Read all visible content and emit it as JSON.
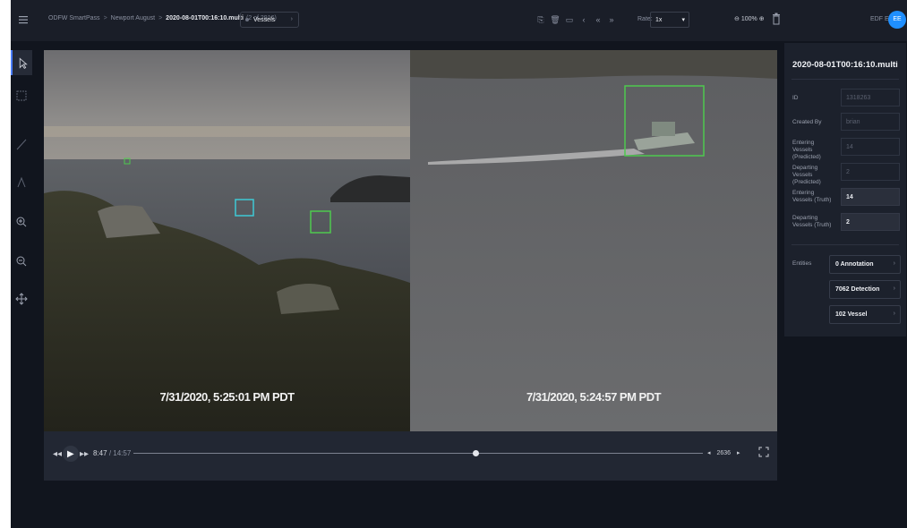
{
  "breadcrumb": [
    "ODFW SmartPass",
    "Newport August",
    "2020-08-01T00:16:10.multi"
  ],
  "breadcrumb_count": "(2 of 2916)",
  "vessel_filter": "Vessels",
  "rate": {
    "label": "Rate:",
    "value": "1x"
  },
  "zoom": "100%",
  "user_name": "EDF EDF",
  "avatar_initials": "EE",
  "tools": [
    "pointer-tool",
    "box-tool",
    "line-tool",
    "point-tool",
    "zoom-in-tool",
    "zoom-out-tool",
    "pan-tool"
  ],
  "cameras": [
    {
      "timestamp": "7/31/2020, 5:25:01 PM PDT"
    },
    {
      "timestamp": "7/31/2020, 5:24:57 PM PDT"
    }
  ],
  "playback": {
    "current": "8:47",
    "total": "/ 14:57",
    "progress": 0.6,
    "frame": "2636"
  },
  "panel": {
    "title": "2020-08-01T00:16:10.multi",
    "fields": [
      {
        "label": "ID",
        "value": "1318263",
        "editable": false
      },
      {
        "label": "Created By",
        "value": "brian",
        "editable": false
      },
      {
        "label": "Entering Vessels (Predicted)",
        "value": "14",
        "editable": false
      },
      {
        "label": "Departing Vessels (Predicted)",
        "value": "2",
        "editable": false
      },
      {
        "label": "Entering Vessels (Truth)",
        "value": "14",
        "editable": true
      },
      {
        "label": "Departing Vessels (Truth)",
        "value": "2",
        "editable": true
      }
    ],
    "entities_label": "Entities",
    "entities": [
      "0 Annotation",
      "7062 Detection",
      "102 Vessel"
    ]
  },
  "colors": {
    "accent": "#1f8fff",
    "detection_green": "#4ec94e",
    "detection_cyan": "#3fc9d6"
  }
}
